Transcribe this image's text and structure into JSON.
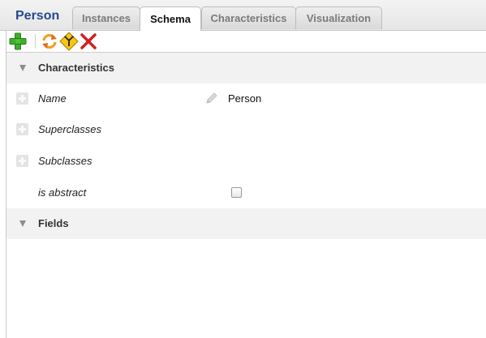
{
  "app": {
    "title": "Person"
  },
  "tabs": [
    {
      "label": "Instances",
      "active": false
    },
    {
      "label": "Schema",
      "active": true
    },
    {
      "label": "Characteristics",
      "active": false
    },
    {
      "label": "Visualization",
      "active": false
    }
  ],
  "toolbar": {
    "buttons": [
      {
        "icon": "add-icon"
      },
      {
        "icon": "refresh-icon"
      },
      {
        "icon": "merge-icon"
      },
      {
        "icon": "delete-icon"
      }
    ]
  },
  "sections": {
    "characteristics": {
      "label": "Characteristics"
    },
    "fields": {
      "label": "Fields"
    }
  },
  "rows": {
    "name": {
      "label": "Name",
      "value": "Person"
    },
    "superclasses": {
      "label": "Superclasses"
    },
    "subclasses": {
      "label": "Subclasses"
    },
    "is_abstract": {
      "label": "is abstract",
      "checked": false
    }
  },
  "colors": {
    "title": "#254a8c",
    "section_bg": "#f2f2f2",
    "tab_inactive_text": "#7b7b7b"
  }
}
